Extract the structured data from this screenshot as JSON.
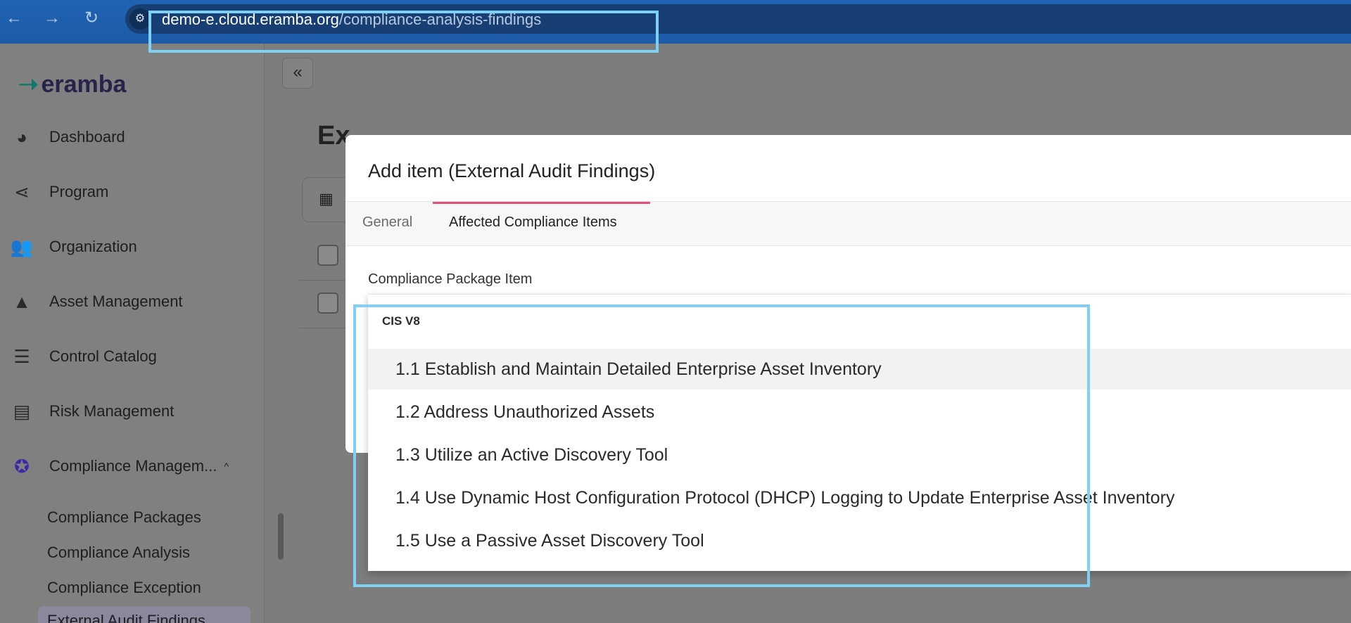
{
  "browser": {
    "url_host": "demo-e.cloud.eramba.org",
    "url_path": "/compliance-analysis-findings"
  },
  "sidebar": {
    "logo": "eramba",
    "items": [
      {
        "label": "Dashboard",
        "icon": "dashboard-gauge-icon"
      },
      {
        "label": "Program",
        "icon": "program-share-icon"
      },
      {
        "label": "Organization",
        "icon": "organization-people-icon"
      },
      {
        "label": "Asset Management",
        "icon": "asset-shapes-icon"
      },
      {
        "label": "Control Catalog",
        "icon": "control-sliders-icon"
      },
      {
        "label": "Risk Management",
        "icon": "risk-list-icon"
      },
      {
        "label": "Compliance Managem...",
        "icon": "compliance-badge-icon"
      }
    ],
    "sub_items": [
      {
        "label": "Compliance Packages"
      },
      {
        "label": "Compliance Analysis"
      },
      {
        "label": "Compliance Exception"
      },
      {
        "label": "External Audit Findings"
      }
    ]
  },
  "main": {
    "page_title_partial": "Ex"
  },
  "modal": {
    "title": "Add item (External Audit Findings)",
    "tabs": [
      {
        "label": "General"
      },
      {
        "label": "Affected Compliance Items"
      }
    ],
    "active_tab": "Affected Compliance Items",
    "field_label": "Compliance Package Item",
    "select_value": ""
  },
  "dropdown": {
    "group": "CIS V8",
    "options": [
      {
        "label": "1.1 Establish and Maintain Detailed Enterprise Asset Inventory"
      },
      {
        "label": "1.2 Address Unauthorized Assets"
      },
      {
        "label": "1.3 Utilize an Active Discovery Tool"
      },
      {
        "label": "1.4 Use Dynamic Host Configuration Protocol (DHCP) Logging to Update Enterprise Asset Inventory"
      },
      {
        "label": "1.5 Use a Passive Asset Discovery Tool"
      }
    ]
  },
  "colors": {
    "browser_bar": "#1f63b3",
    "tab_indicator": "#e0527a",
    "annotation_highlight": "#7fd0f5"
  }
}
